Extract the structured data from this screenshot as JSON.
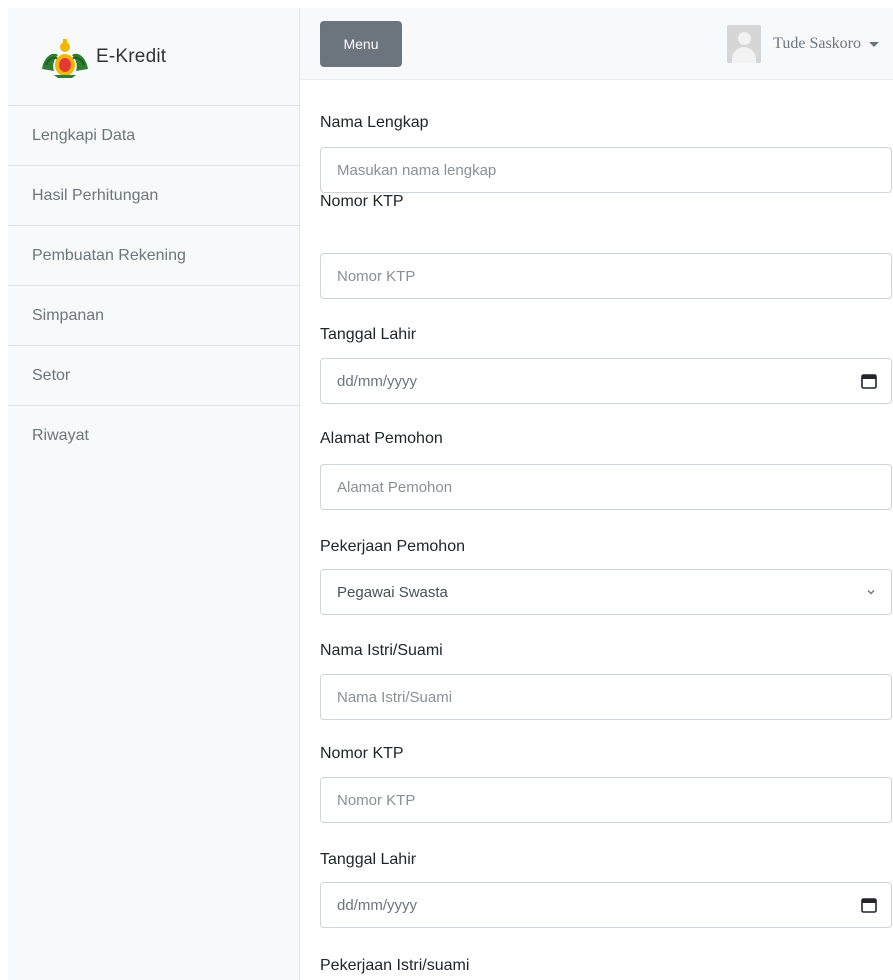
{
  "brand": {
    "name": "E-Kredit",
    "logo_icon": "garuda-logo-icon"
  },
  "sidebar": {
    "items": [
      {
        "label": "Lengkapi Data"
      },
      {
        "label": "Hasil Perhitungan"
      },
      {
        "label": "Pembuatan Rekening"
      },
      {
        "label": "Simpanan"
      },
      {
        "label": "Setor"
      },
      {
        "label": "Riwayat"
      }
    ]
  },
  "topbar": {
    "menu_label": "Menu",
    "user_name": "Tude Saskoro",
    "avatar_icon": "user-avatar-icon",
    "dropdown_icon": "caret-down-icon"
  },
  "form": {
    "nama_lengkap": {
      "label": "Nama Lengkap",
      "placeholder": "Masukan nama lengkap"
    },
    "nomor_ktp": {
      "label": "Nomor KTP",
      "placeholder": "Nomor KTP"
    },
    "tanggal_lahir": {
      "label": "Tanggal Lahir",
      "value": "dd/mm/yyyy"
    },
    "alamat": {
      "label": "Alamat Pemohon",
      "placeholder": "Alamat Pemohon"
    },
    "pekerjaan": {
      "label": "Pekerjaan Pemohon",
      "selected": "Pegawai Swasta"
    },
    "nama_pasangan": {
      "label": "Nama Istri/Suami",
      "placeholder": "Nama Istri/Suami"
    },
    "nomor_ktp_pasangan": {
      "label": "Nomor KTP",
      "placeholder": "Nomor KTP"
    },
    "tanggal_lahir_pasangan": {
      "label": "Tanggal Lahir",
      "value": "dd/mm/yyyy"
    },
    "pekerjaan_pasangan": {
      "label": "Pekerjaan Istri/suami"
    }
  },
  "colors": {
    "sidebar_bg": "#f8f9fa",
    "menu_button": "#6c757d",
    "border": "#ced4da"
  }
}
